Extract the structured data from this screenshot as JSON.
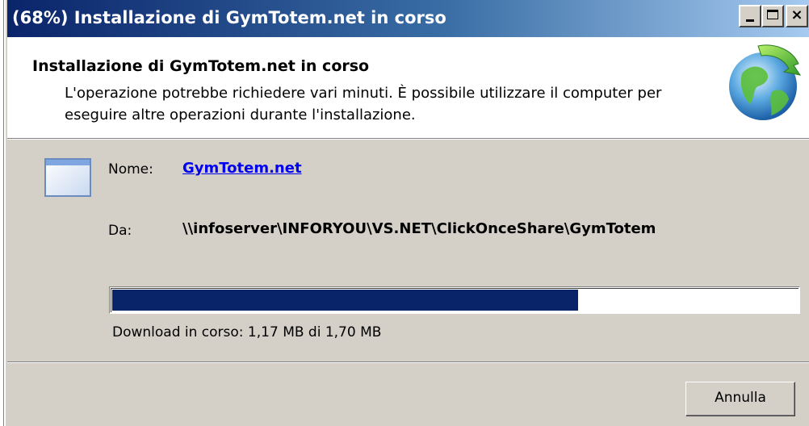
{
  "window": {
    "title": "(68%) Installazione di GymTotem.net in corso",
    "controls": {
      "minimize": "minimize",
      "maximize": "maximize",
      "close": "×"
    }
  },
  "header": {
    "title": "Installazione di GymTotem.net in corso",
    "description": "L'operazione potrebbe richiedere vari minuti. È possibile utilizzare il computer per eseguire altre operazioni durante l'installazione."
  },
  "details": {
    "name_label": "Nome:",
    "name_value": "GymTotem.net",
    "from_label": "Da:",
    "from_value": "\\\\infoserver\\INFORYOU\\VS.NET\\ClickOnceShare\\GymTotem"
  },
  "progress": {
    "fraction": 0.68,
    "status_text": "Download in corso: 1,17 MB di 1,70 MB"
  },
  "buttons": {
    "cancel": "Annulla"
  },
  "icons": [
    "globe-icon",
    "application-window-icon"
  ],
  "colors": {
    "titlebar_start": "#0a246a",
    "titlebar_end": "#a6caf0",
    "progress_fill": "#0a246a",
    "link": "#0000ee"
  }
}
